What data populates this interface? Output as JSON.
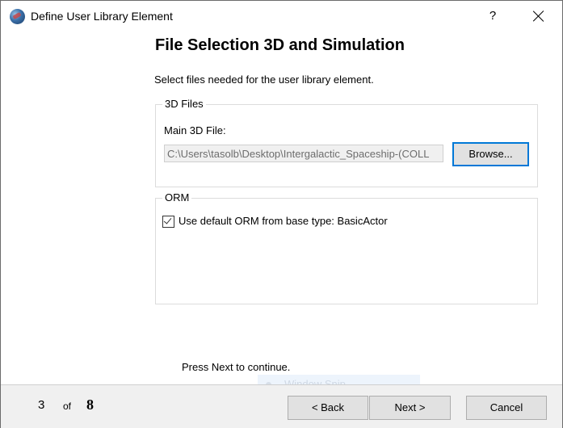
{
  "window": {
    "title": "Define User Library Element",
    "help_label": "?",
    "close_icon": "close-icon"
  },
  "page": {
    "heading": "File Selection 3D and Simulation",
    "instruction": "Select files needed for the user library element."
  },
  "files_group": {
    "legend": "3D Files",
    "main_file_label": "Main 3D File:",
    "main_file_value": "C:\\Users\\tasolb\\Desktop\\Intergalactic_Spaceship-(COLL",
    "browse_label": "Browse..."
  },
  "orm_group": {
    "legend": "ORM",
    "use_default_checked": true,
    "use_default_label": "Use default ORM from base type: BasicActor"
  },
  "hint": "Press Next to continue.",
  "overlay": {
    "snip_label": "Window Snip"
  },
  "footer": {
    "current_step": "3",
    "of_label": "of",
    "total_steps": "8",
    "back_label": "< Back",
    "next_label": "Next >",
    "cancel_label": "Cancel"
  }
}
